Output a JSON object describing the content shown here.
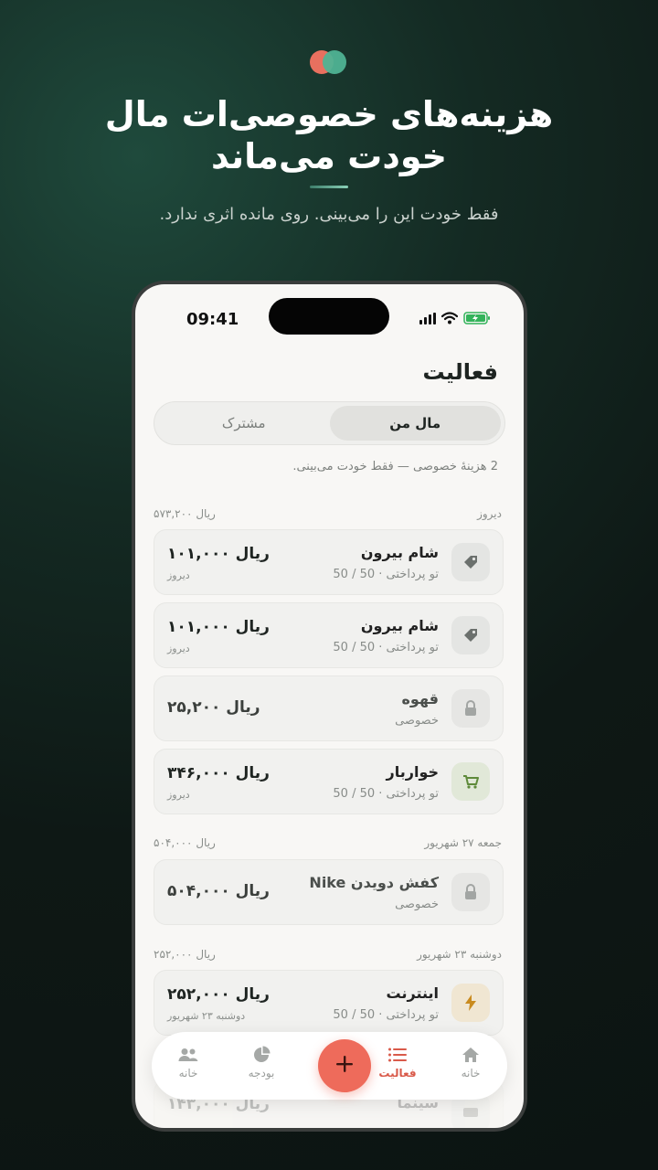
{
  "hero": {
    "headline_line1": "هزینه‌های خصوصی‌ات مال",
    "headline_line2": "خودت می‌ماند",
    "subline": "فقط خودت این را می‌بینی. روی مانده اثری ندارد."
  },
  "status_bar": {
    "time": "09:41"
  },
  "page": {
    "title": "فعالیت"
  },
  "segments": {
    "mine": "مال من",
    "shared": "مشترک",
    "selected": "mine"
  },
  "info_line": "2 هزینهٔ خصوصی — فقط خودت می‌بینی.",
  "groups": [
    {
      "label": "دیروز",
      "total": "ریال ۵۷۳,۲۰۰",
      "items": [
        {
          "title": "شام بیرون",
          "subtitle": "تو پرداختی · 50 / 50",
          "amount": "ریال ۱۰۱,۰۰۰",
          "date": "دیروز",
          "icon": "tag-icon",
          "private": false
        },
        {
          "title": "شام بیرون",
          "subtitle": "تو پرداختی · 50 / 50",
          "amount": "ریال ۱۰۱,۰۰۰",
          "date": "دیروز",
          "icon": "tag-icon",
          "private": false
        },
        {
          "title": "قهوه",
          "subtitle": "خصوصی",
          "amount": "ریال ۲۵,۲۰۰",
          "date": "",
          "icon": "lock-icon",
          "private": true
        },
        {
          "title": "خواربار",
          "subtitle": "تو پرداختی · 50 / 50",
          "amount": "ریال ۳۴۶,۰۰۰",
          "date": "دیروز",
          "icon": "cart-icon",
          "private": false
        }
      ]
    },
    {
      "label": "جمعه ۲۷ شهریور",
      "total": "ریال ۵۰۴,۰۰۰",
      "items": [
        {
          "title": "کفش دویدن Nike",
          "subtitle": "خصوصی",
          "amount": "ریال ۵۰۴,۰۰۰",
          "date": "",
          "icon": "lock-icon",
          "private": true
        }
      ]
    },
    {
      "label": "دوشنبه ۲۳ شهریور",
      "total": "ریال ۲۵۲,۰۰۰",
      "items": [
        {
          "title": "اینترنت",
          "subtitle": "تو پرداختی · 50 / 50",
          "amount": "ریال ۲۵۲,۰۰۰",
          "date": "دوشنبه ۲۳ شهریور",
          "icon": "bolt-icon",
          "private": false
        },
        {
          "title": "سینما",
          "subtitle": "",
          "amount": "ریال ۱۴۳,۰۰۰",
          "date": "",
          "icon": "ticket-icon",
          "private": false
        }
      ]
    }
  ],
  "tabbar": {
    "home": "خانه",
    "activity": "فعالیت",
    "budget": "بودجه",
    "people": "خانه",
    "active": "activity"
  },
  "colors": {
    "accent": "#ee6b5b",
    "brand_green": "#4fb394",
    "background": "#0e1815"
  }
}
